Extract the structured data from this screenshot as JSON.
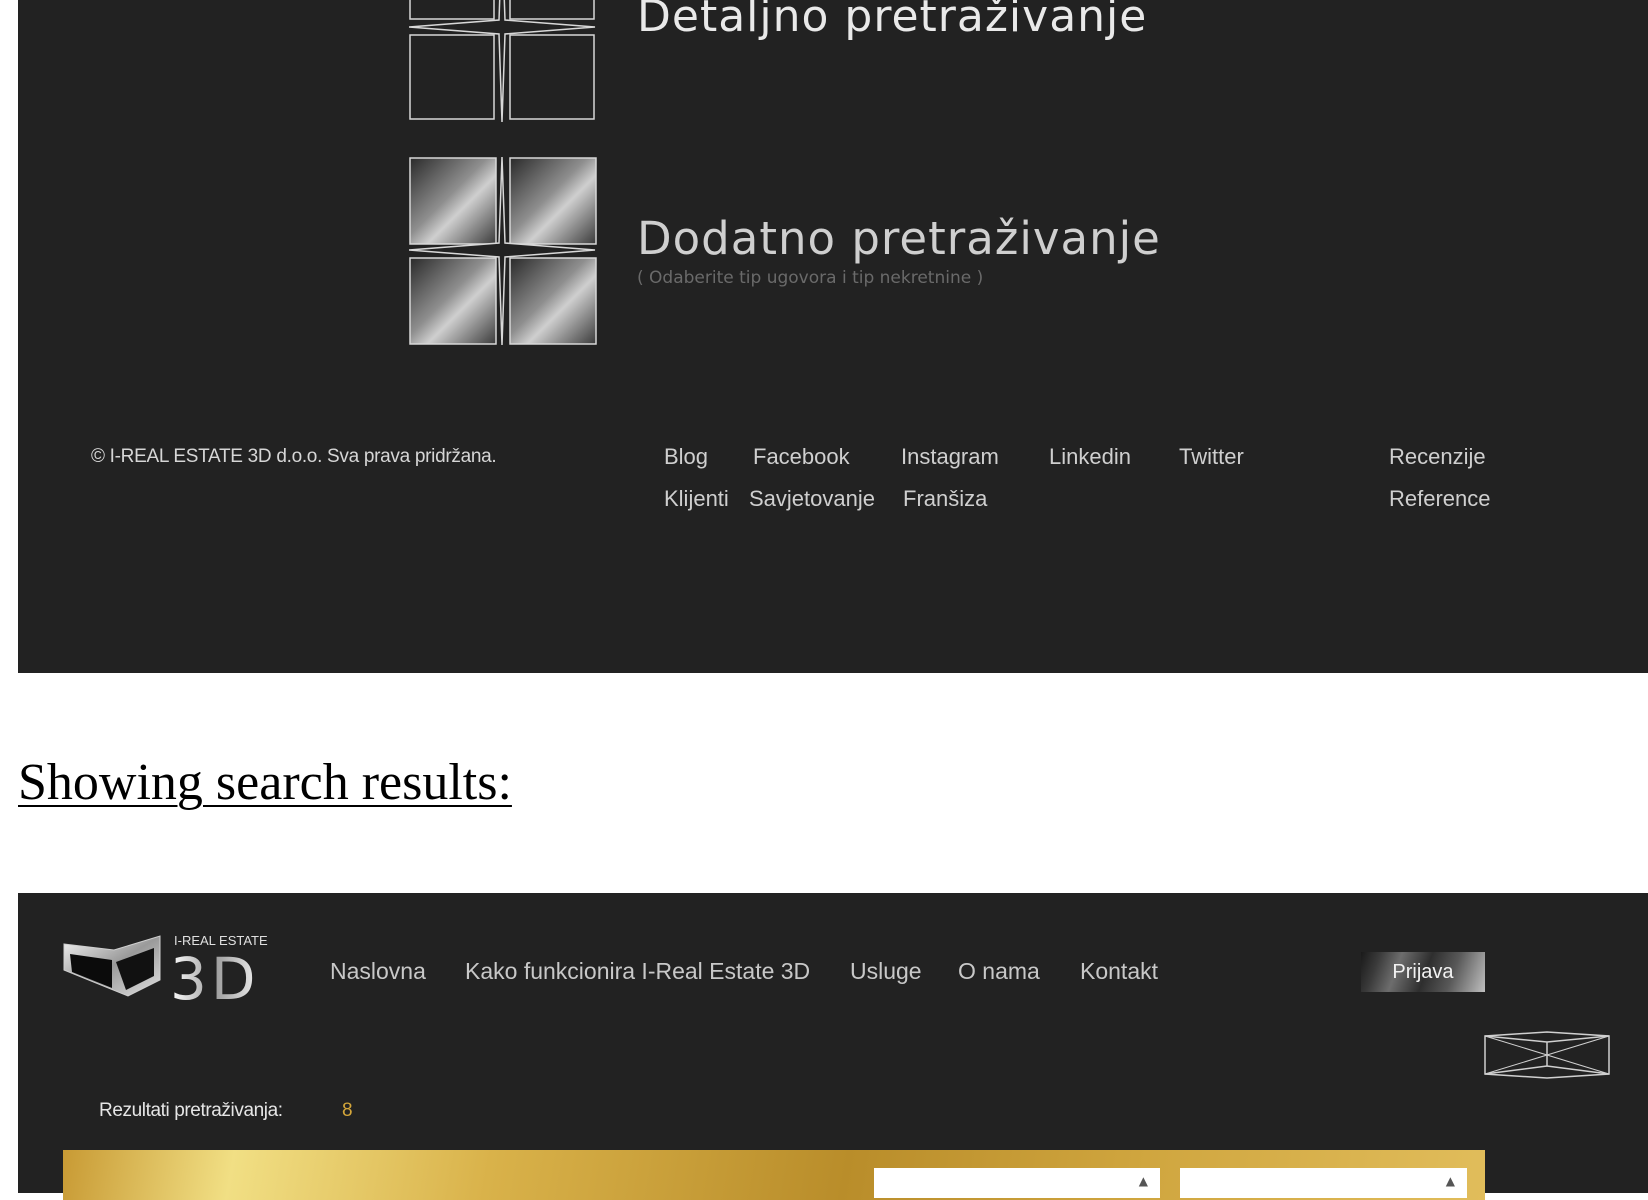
{
  "search_panel": {
    "detail_title": "Detaljno pretraživanje",
    "extra_title": "Dodatno pretraživanje",
    "extra_subtitle": "( Odaberite tip ugovora i tip nekretnine )"
  },
  "footer": {
    "copyright": "© I-REAL ESTATE 3D d.o.o. Sva prava pridržana.",
    "links_row1": [
      "Blog",
      "Facebook",
      "Instagram",
      "Linkedin",
      "Twitter"
    ],
    "links_row2": [
      "Klijenti",
      "Savjetovanje",
      "Franšiza"
    ],
    "links_right": [
      "Recenzije",
      "Reference"
    ]
  },
  "results_heading": "Showing search results:",
  "header": {
    "logo_small": "I-REAL ESTATE",
    "logo_big": "3D",
    "nav": [
      "Naslovna",
      "Kako funkcionira I-Real Estate 3D",
      "Usluge",
      "O nama",
      "Kontakt"
    ],
    "login_label": "Prijava"
  },
  "results": {
    "label": "Rezultati pretraživanja:",
    "count": "8"
  },
  "colors": {
    "panel_bg": "#222222",
    "gold_accent": "#d4a63a"
  },
  "icons": [
    "detail-search-icon",
    "extra-search-icon",
    "view-toggle-icon",
    "logo-icon"
  ]
}
